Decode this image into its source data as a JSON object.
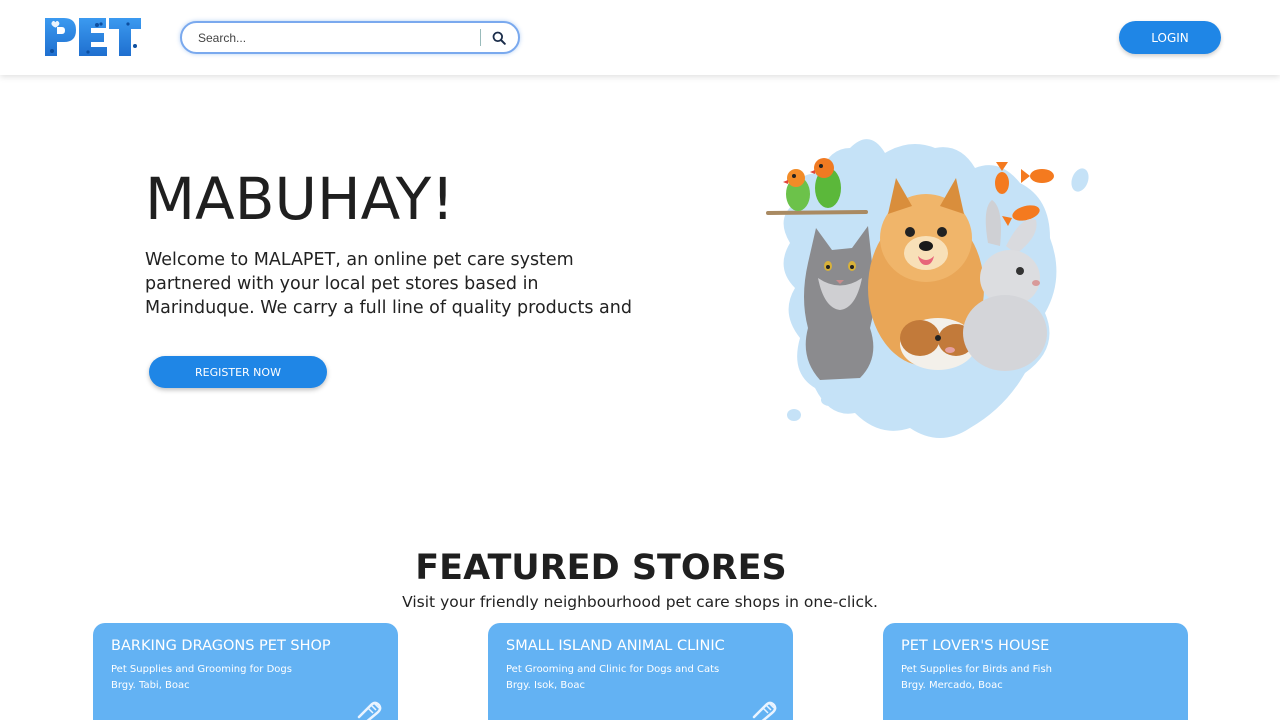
{
  "header": {
    "logo_text": "PET",
    "search": {
      "placeholder": "Search...",
      "value": ""
    },
    "login_label": "LOGIN"
  },
  "hero": {
    "title": "MABUHAY!",
    "text": "Welcome to MALAPET, an online pet care system partnered with your local pet stores based in Marinduque. We carry a full line of quality products and services for your dogs, cats, small",
    "register_label": "REGISTER NOW"
  },
  "featured": {
    "title": "FEATURED STORES",
    "subtitle": "Visit your friendly neighbourhood pet care shops in one-click.",
    "stores": [
      {
        "name": "BARKING DRAGONS PET SHOP",
        "description": "Pet Supplies and Grooming for Dogs",
        "address": "Brgy. Tabi, Boac",
        "icon": "grooming-brush-icon"
      },
      {
        "name": "SMALL ISLAND ANIMAL CLINIC",
        "description": "Pet Grooming and Clinic for Dogs and Cats",
        "address": "Brgy. Isok, Boac",
        "icon": "grooming-brush-icon"
      },
      {
        "name": "PET LOVER'S HOUSE",
        "description": "Pet Supplies for Birds and Fish",
        "address": "Brgy. Mercado, Boac",
        "icon": "grooming-brush-icon"
      }
    ]
  },
  "colors": {
    "primary": "#1f86e6",
    "card": "#63b2f3",
    "splash": "#c5e2f7",
    "logo": "#2f8be8"
  }
}
